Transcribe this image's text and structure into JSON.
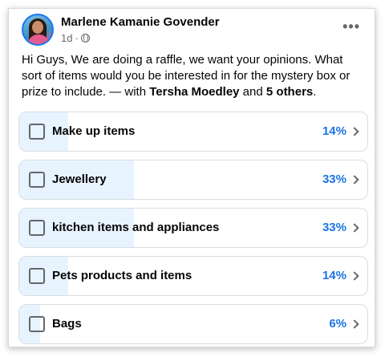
{
  "post": {
    "author": "Marlene Kamanie Govender",
    "time": "1d",
    "separator": "·",
    "privacy_icon": "globe-icon",
    "more_icon": "ellipsis-icon",
    "more_label": "•••",
    "text_main": "Hi Guys, We are doing a raffle, we want your opinions. What sort of items would you be interested in for the mystery box or prize to include. — with ",
    "tag_name": "Tersha Moedley",
    "tag_and": " and ",
    "tag_others": "5 others",
    "tag_end": "."
  },
  "poll": {
    "accent_color": "#1b74e4",
    "fill_color": "#e7f3ff",
    "options": [
      {
        "label": "Make up items",
        "percent_label": "14%",
        "percent": 14
      },
      {
        "label": "Jewellery",
        "percent_label": "33%",
        "percent": 33
      },
      {
        "label": "kitchen items and appliances",
        "percent_label": "33%",
        "percent": 33
      },
      {
        "label": "Pets products and items",
        "percent_label": "14%",
        "percent": 14
      },
      {
        "label": "Bags",
        "percent_label": "6%",
        "percent": 6
      }
    ]
  }
}
